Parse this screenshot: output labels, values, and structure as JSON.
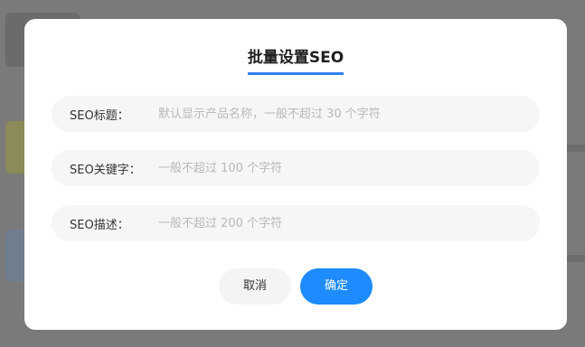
{
  "dialog": {
    "title": "批量设置SEO",
    "accent_color": "#2f80ed",
    "fields": [
      {
        "label": "SEO标题：",
        "value": "",
        "placeholder": "默认显示产品名称，一般不超过 30 个字符"
      },
      {
        "label": "SEO关键字：",
        "value": "",
        "placeholder": "一般不超过 100 个字符"
      },
      {
        "label": "SEO描述：",
        "value": "",
        "placeholder": "一般不超过 200 个字符"
      }
    ],
    "buttons": {
      "cancel_label": "取消",
      "confirm_label": "确定",
      "confirm_color": "#1e8cff"
    }
  }
}
